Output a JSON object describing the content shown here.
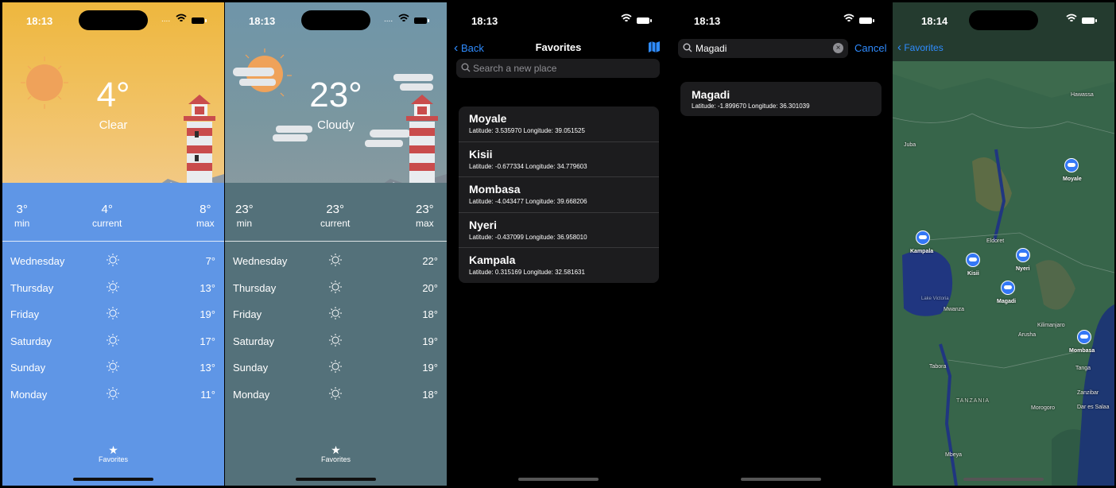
{
  "screens": [
    {
      "status_time": "18:13",
      "temperature": "4°",
      "condition": "Clear",
      "min_value": "3°",
      "min_label": "min",
      "current_value": "4°",
      "current_label": "current",
      "max_value": "8°",
      "max_label": "max",
      "forecast": [
        {
          "day": "Wednesday",
          "temp": "7°"
        },
        {
          "day": "Thursday",
          "temp": "13°"
        },
        {
          "day": "Friday",
          "temp": "19°"
        },
        {
          "day": "Saturday",
          "temp": "17°"
        },
        {
          "day": "Sunday",
          "temp": "13°"
        },
        {
          "day": "Monday",
          "temp": "11°"
        }
      ],
      "tab_label": "Favorites"
    },
    {
      "status_time": "18:13",
      "temperature": "23°",
      "condition": "Cloudy",
      "min_value": "23°",
      "min_label": "min",
      "current_value": "23°",
      "current_label": "current",
      "max_value": "23°",
      "max_label": "max",
      "forecast": [
        {
          "day": "Wednesday",
          "temp": "22°"
        },
        {
          "day": "Thursday",
          "temp": "20°"
        },
        {
          "day": "Friday",
          "temp": "18°"
        },
        {
          "day": "Saturday",
          "temp": "19°"
        },
        {
          "day": "Sunday",
          "temp": "19°"
        },
        {
          "day": "Monday",
          "temp": "18°"
        }
      ],
      "tab_label": "Favorites"
    }
  ],
  "favorites_screen": {
    "status_time": "18:13",
    "back_label": "Back",
    "title": "Favorites",
    "search_placeholder": "Search a new place",
    "places": [
      {
        "name": "Moyale",
        "coords": "Latitude: 3.535970   Longitude: 39.051525"
      },
      {
        "name": "Kisii",
        "coords": "Latitude: -0.677334   Longitude: 34.779603"
      },
      {
        "name": "Mombasa",
        "coords": "Latitude: -4.043477   Longitude: 39.668206"
      },
      {
        "name": "Nyeri",
        "coords": "Latitude: -0.437099   Longitude: 36.958010"
      },
      {
        "name": "Kampala",
        "coords": "Latitude: 0.315169   Longitude: 32.581631"
      }
    ]
  },
  "search_screen": {
    "status_time": "18:13",
    "query": "Magadi",
    "cancel_label": "Cancel",
    "result_name": "Magadi",
    "result_coords": "Latitude: -1.899670   Longitude: 36.301039"
  },
  "map_screen": {
    "status_time": "18:14",
    "back_label": "Favorites",
    "pins": [
      "Moyale",
      "Kampala",
      "Kisii",
      "Nyeri",
      "Magadi",
      "Mombasa"
    ],
    "map_labels": [
      "Hawassa",
      "Juba",
      "Eldoret",
      "Kilimanjaro",
      "Arusha",
      "Mwanza",
      "Lake Victoria",
      "Tabora",
      "Tanga",
      "Zanzibar",
      "Dar es Salaa",
      "Morogoro",
      "TANZANIA",
      "Mbeya"
    ]
  },
  "colors": {
    "clear_bg": "#5f96e6",
    "cloudy_bg": "#54717a",
    "accent": "#2f8cff",
    "pin": "#3478f6"
  }
}
